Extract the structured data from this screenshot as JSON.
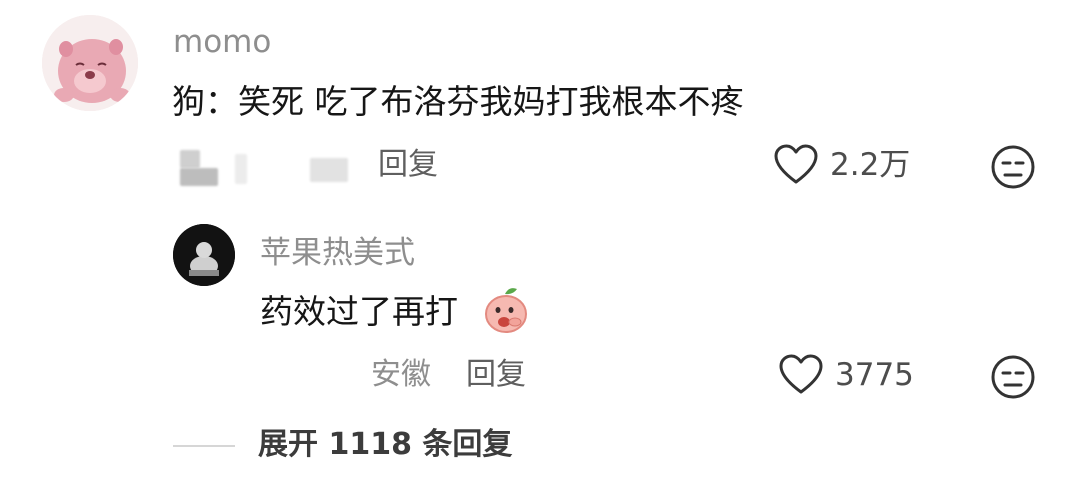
{
  "comment": {
    "username": "momo",
    "text": "狗：笑死 吃了布洛芬我妈打我根本不疼",
    "reply_label": "回复",
    "like_count": "2.2万"
  },
  "reply": {
    "username": "苹果热美式",
    "text": "药效过了再打",
    "location": "安徽",
    "reply_label": "回复",
    "like_count": "3775"
  },
  "expand": {
    "label": "展开 1118 条回复"
  },
  "icons": {
    "like": "heart-outline-icon",
    "dislike": "meh-face-icon",
    "sticker": "peach-face-sticker-icon"
  },
  "colors": {
    "username": "#8e8e8e",
    "text": "#161616",
    "secondary": "#5f5f5f"
  }
}
